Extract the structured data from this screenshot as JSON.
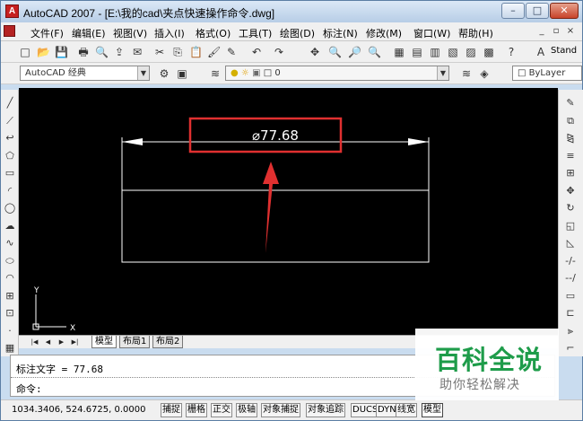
{
  "window": {
    "app_icon": "A",
    "title": "AutoCAD 2007 - [E:\\我的cad\\夹点快速操作命令.dwg]",
    "min_glyph": "–",
    "max_glyph": "□",
    "close_glyph": "✕"
  },
  "menu": {
    "items": [
      "文件(F)",
      "编辑(E)",
      "视图(V)",
      "插入(I)",
      "格式(O)",
      "工具(T)",
      "绘图(D)",
      "标注(N)",
      "修改(M)",
      "窗口(W)",
      "帮助(H)"
    ],
    "mdi_buttons": [
      "_",
      "▫",
      "×"
    ]
  },
  "toolbar1": {
    "icons": [
      "new-icon",
      "open-icon",
      "save-icon",
      "print-icon",
      "print-preview-icon",
      "publish-icon",
      "plot-icon",
      "cut-icon",
      "copy-icon",
      "paste-icon",
      "match-properties-icon",
      "block-editor-icon",
      "undo-icon",
      "redo-icon",
      "pan-icon",
      "zoom-realtime-icon",
      "zoom-window-icon",
      "zoom-previous-icon",
      "properties-icon",
      "design-center-icon",
      "tool-palettes-icon",
      "sheet-set-icon",
      "markup-icon",
      "calculator-icon",
      "help-icon",
      "text-style-icon"
    ],
    "glyphs": [
      "□",
      "📂",
      "💾",
      "🖶",
      "🔍",
      "⇪",
      "✉",
      "✂",
      "⎘",
      "📋",
      "🖌",
      "✎",
      "↶",
      "↷",
      "✥",
      "🔍",
      "🔎",
      "🔍",
      "▦",
      "▤",
      "▥",
      "▧",
      "▨",
      "▩",
      "?",
      "A"
    ],
    "text_style_value": "Stand"
  },
  "toolbar2": {
    "workspace": "AutoCAD 经典",
    "layer_icons": [
      "layer-manager-icon",
      "bulb-icon",
      "sun-icon",
      "lock-icon",
      "color-square-icon"
    ],
    "layer_name": "0",
    "color_value": "ByLayer"
  },
  "left_toolbar": {
    "icons": [
      "line-icon",
      "construction-line-icon",
      "polyline-icon",
      "polygon-icon",
      "rectangle-icon",
      "arc-icon",
      "circle-icon",
      "revision-cloud-icon",
      "spline-icon",
      "ellipse-icon",
      "ellipse-arc-icon",
      "insert-block-icon",
      "make-block-icon",
      "point-icon",
      "hatch-icon"
    ],
    "glyphs": [
      "╱",
      "⟋",
      "↩",
      "⬠",
      "▭",
      "◜",
      "◯",
      "☁",
      "∿",
      "⬭",
      "◠",
      "⊞",
      "⊡",
      "·",
      "▦"
    ]
  },
  "right_toolbar": {
    "icons": [
      "erase-icon",
      "copy-object-icon",
      "mirror-icon",
      "offset-icon",
      "array-icon",
      "move-icon",
      "rotate-icon",
      "scale-icon",
      "stretch-icon",
      "trim-icon",
      "extend-icon",
      "break-icon",
      "join-icon",
      "chamfer-icon",
      "fillet-icon"
    ],
    "glyphs": [
      "✎",
      "⧉",
      "⧎",
      "≡",
      "⊞",
      "✥",
      "↻",
      "◱",
      "◺",
      "-/-",
      "--/",
      "▭",
      "⊏",
      "⫸",
      "⌐"
    ]
  },
  "drawing": {
    "dimension_text": "⌀77.68",
    "ucs_y": "Y",
    "ucs_x": "X"
  },
  "layout_tabs": {
    "nav": [
      "|◀",
      "◀",
      "▶",
      "▶|"
    ],
    "tabs": [
      "模型",
      "布局1",
      "布局2"
    ]
  },
  "command": {
    "history": "标注文字 = 77.68",
    "prompt": "命令:"
  },
  "status": {
    "coordinates": "1034.3406, 524.6725, 0.0000",
    "buttons": [
      "捕捉",
      "栅格",
      "正交",
      "极轴",
      "对象捕捉",
      "对象追踪",
      "DUCS",
      "DYN",
      "线宽",
      "模型"
    ]
  },
  "watermark": {
    "title": "百科全说",
    "subtitle": "助你轻松解决"
  },
  "colors": {
    "annotation": "#e03030",
    "drawing_lines": "#ffffff",
    "watermark_green": "#1e9c4a"
  }
}
